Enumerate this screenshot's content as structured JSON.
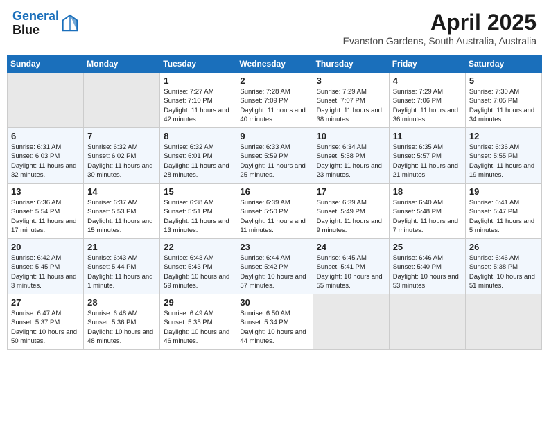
{
  "header": {
    "logo_line1": "General",
    "logo_line2": "Blue",
    "month_title": "April 2025",
    "subtitle": "Evanston Gardens, South Australia, Australia"
  },
  "days_of_week": [
    "Sunday",
    "Monday",
    "Tuesday",
    "Wednesday",
    "Thursday",
    "Friday",
    "Saturday"
  ],
  "weeks": [
    [
      {
        "day": "",
        "empty": true
      },
      {
        "day": "",
        "empty": true
      },
      {
        "day": "1",
        "sunrise": "7:27 AM",
        "sunset": "7:10 PM",
        "daylight": "11 hours and 42 minutes."
      },
      {
        "day": "2",
        "sunrise": "7:28 AM",
        "sunset": "7:09 PM",
        "daylight": "11 hours and 40 minutes."
      },
      {
        "day": "3",
        "sunrise": "7:29 AM",
        "sunset": "7:07 PM",
        "daylight": "11 hours and 38 minutes."
      },
      {
        "day": "4",
        "sunrise": "7:29 AM",
        "sunset": "7:06 PM",
        "daylight": "11 hours and 36 minutes."
      },
      {
        "day": "5",
        "sunrise": "7:30 AM",
        "sunset": "7:05 PM",
        "daylight": "11 hours and 34 minutes."
      }
    ],
    [
      {
        "day": "6",
        "sunrise": "6:31 AM",
        "sunset": "6:03 PM",
        "daylight": "11 hours and 32 minutes."
      },
      {
        "day": "7",
        "sunrise": "6:32 AM",
        "sunset": "6:02 PM",
        "daylight": "11 hours and 30 minutes."
      },
      {
        "day": "8",
        "sunrise": "6:32 AM",
        "sunset": "6:01 PM",
        "daylight": "11 hours and 28 minutes."
      },
      {
        "day": "9",
        "sunrise": "6:33 AM",
        "sunset": "5:59 PM",
        "daylight": "11 hours and 25 minutes."
      },
      {
        "day": "10",
        "sunrise": "6:34 AM",
        "sunset": "5:58 PM",
        "daylight": "11 hours and 23 minutes."
      },
      {
        "day": "11",
        "sunrise": "6:35 AM",
        "sunset": "5:57 PM",
        "daylight": "11 hours and 21 minutes."
      },
      {
        "day": "12",
        "sunrise": "6:36 AM",
        "sunset": "5:55 PM",
        "daylight": "11 hours and 19 minutes."
      }
    ],
    [
      {
        "day": "13",
        "sunrise": "6:36 AM",
        "sunset": "5:54 PM",
        "daylight": "11 hours and 17 minutes."
      },
      {
        "day": "14",
        "sunrise": "6:37 AM",
        "sunset": "5:53 PM",
        "daylight": "11 hours and 15 minutes."
      },
      {
        "day": "15",
        "sunrise": "6:38 AM",
        "sunset": "5:51 PM",
        "daylight": "11 hours and 13 minutes."
      },
      {
        "day": "16",
        "sunrise": "6:39 AM",
        "sunset": "5:50 PM",
        "daylight": "11 hours and 11 minutes."
      },
      {
        "day": "17",
        "sunrise": "6:39 AM",
        "sunset": "5:49 PM",
        "daylight": "11 hours and 9 minutes."
      },
      {
        "day": "18",
        "sunrise": "6:40 AM",
        "sunset": "5:48 PM",
        "daylight": "11 hours and 7 minutes."
      },
      {
        "day": "19",
        "sunrise": "6:41 AM",
        "sunset": "5:47 PM",
        "daylight": "11 hours and 5 minutes."
      }
    ],
    [
      {
        "day": "20",
        "sunrise": "6:42 AM",
        "sunset": "5:45 PM",
        "daylight": "11 hours and 3 minutes."
      },
      {
        "day": "21",
        "sunrise": "6:43 AM",
        "sunset": "5:44 PM",
        "daylight": "11 hours and 1 minute."
      },
      {
        "day": "22",
        "sunrise": "6:43 AM",
        "sunset": "5:43 PM",
        "daylight": "10 hours and 59 minutes."
      },
      {
        "day": "23",
        "sunrise": "6:44 AM",
        "sunset": "5:42 PM",
        "daylight": "10 hours and 57 minutes."
      },
      {
        "day": "24",
        "sunrise": "6:45 AM",
        "sunset": "5:41 PM",
        "daylight": "10 hours and 55 minutes."
      },
      {
        "day": "25",
        "sunrise": "6:46 AM",
        "sunset": "5:40 PM",
        "daylight": "10 hours and 53 minutes."
      },
      {
        "day": "26",
        "sunrise": "6:46 AM",
        "sunset": "5:38 PM",
        "daylight": "10 hours and 51 minutes."
      }
    ],
    [
      {
        "day": "27",
        "sunrise": "6:47 AM",
        "sunset": "5:37 PM",
        "daylight": "10 hours and 50 minutes."
      },
      {
        "day": "28",
        "sunrise": "6:48 AM",
        "sunset": "5:36 PM",
        "daylight": "10 hours and 48 minutes."
      },
      {
        "day": "29",
        "sunrise": "6:49 AM",
        "sunset": "5:35 PM",
        "daylight": "10 hours and 46 minutes."
      },
      {
        "day": "30",
        "sunrise": "6:50 AM",
        "sunset": "5:34 PM",
        "daylight": "10 hours and 44 minutes."
      },
      {
        "day": "",
        "empty": true
      },
      {
        "day": "",
        "empty": true
      },
      {
        "day": "",
        "empty": true
      }
    ]
  ]
}
